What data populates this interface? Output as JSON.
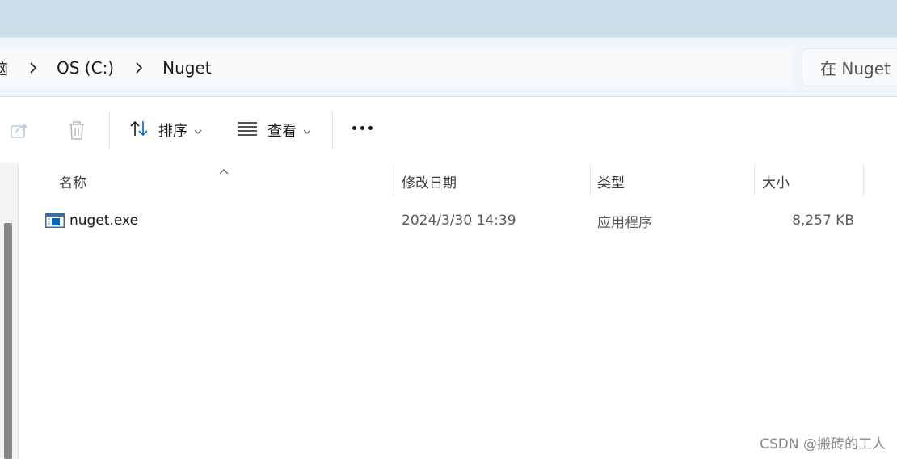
{
  "breadcrumb": {
    "items": [
      "脑",
      "OS (C:)",
      "Nuget"
    ]
  },
  "search": {
    "placeholder": "在 Nuget 中"
  },
  "toolbar": {
    "sort_label": "排序",
    "view_label": "查看"
  },
  "columns": {
    "name": "名称",
    "date": "修改日期",
    "type": "类型",
    "size": "大小"
  },
  "files": [
    {
      "name": "nuget.exe",
      "date": "2024/3/30 14:39",
      "type": "应用程序",
      "size": "8,257 KB"
    }
  ],
  "watermark": "CSDN @搬砖的工人",
  "icons": {
    "share": "share-icon",
    "delete": "trash-icon",
    "sort": "sort-icon",
    "view": "view-icon",
    "more": "more-icon",
    "file": "exe-file-icon"
  },
  "colors": {
    "titlebar": "#cddfeb",
    "accent": "#0067c0"
  }
}
